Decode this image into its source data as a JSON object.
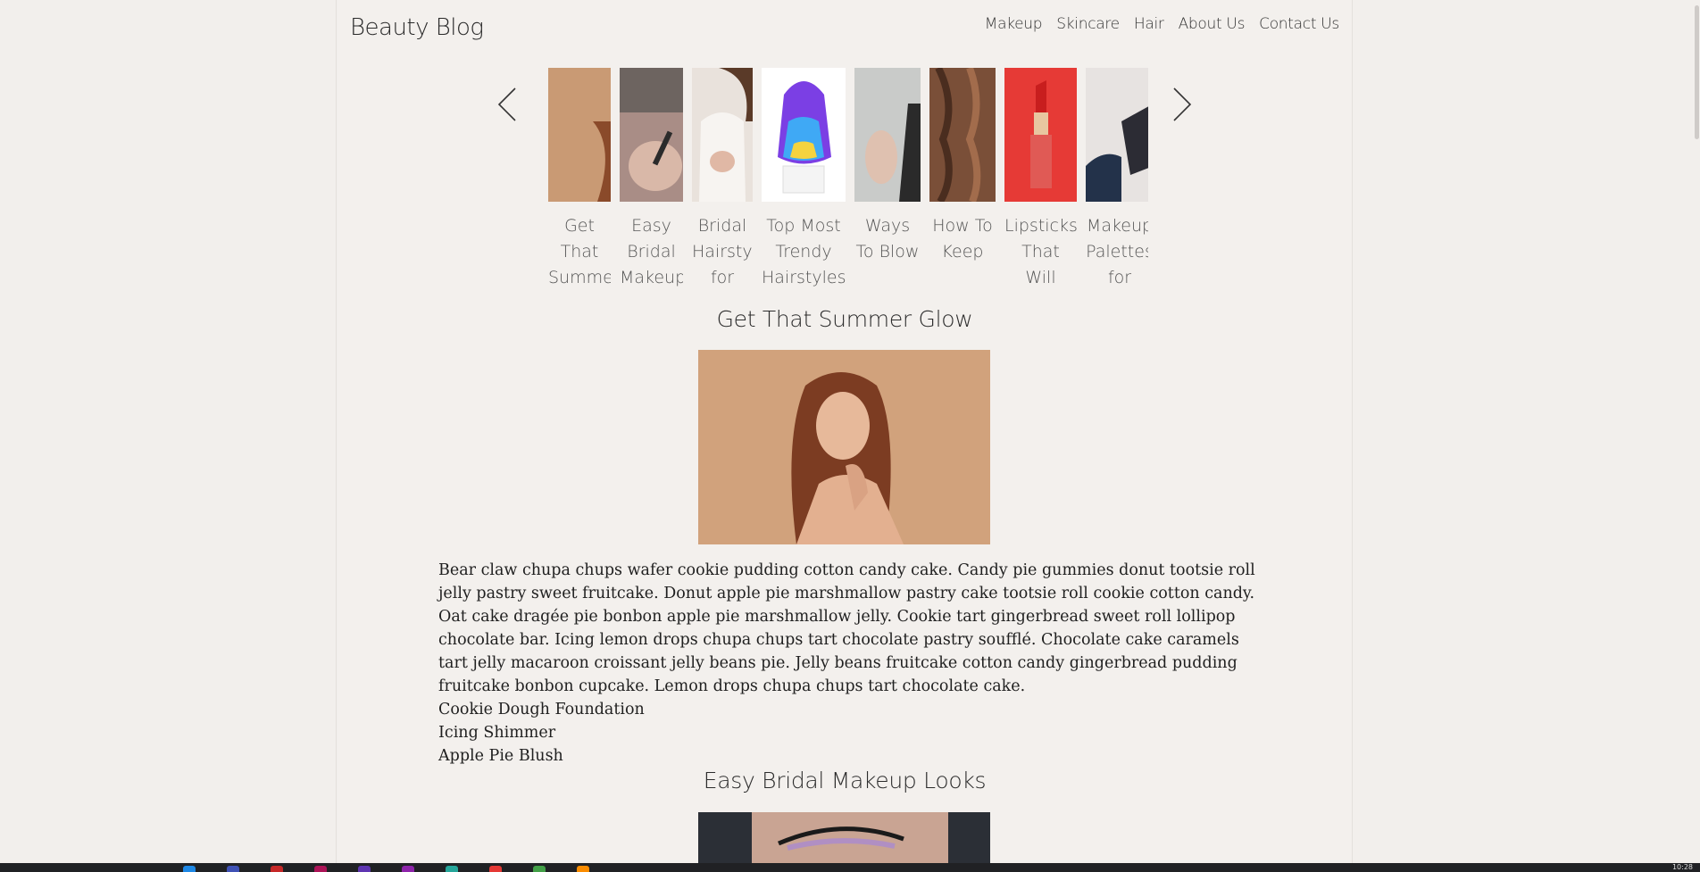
{
  "header": {
    "brand": "Beauty Blog",
    "nav": [
      "Makeup",
      "Skincare",
      "Hair",
      "About Us",
      "Contact Us"
    ]
  },
  "carousel": {
    "prev_icon": "chevron-left-icon",
    "next_icon": "chevron-right-icon",
    "items": [
      {
        "caption": "Get That Summer Glow",
        "color": "#c99a74",
        "icon": "summer-glow-thumbnail"
      },
      {
        "caption": "Easy Bridal Makeup Looks",
        "color": "#a98d86",
        "icon": "bridal-makeup-thumbnail"
      },
      {
        "caption": "Bridal Hairstyles for",
        "color": "#e9e2dc",
        "icon": "bridal-hair-thumbnail"
      },
      {
        "caption": "Top Most Trendy Hairstyles",
        "color": "#ffffff",
        "icon": "rainbow-hair-thumbnail"
      },
      {
        "caption": "Ways To Blow",
        "color": "#c9cbc9",
        "icon": "blow-dry-thumbnail"
      },
      {
        "caption": "How To Keep",
        "color": "#7a4f38",
        "icon": "curly-hair-thumbnail"
      },
      {
        "caption": "Lipsticks That Will",
        "color": "#e63a36",
        "icon": "lipstick-thumbnail"
      },
      {
        "caption": "Makeup Palettes for",
        "color": "#e7e3e1",
        "icon": "palette-thumbnail"
      }
    ]
  },
  "posts": [
    {
      "title": "Get That Summer Glow",
      "image_icon": "woman-summer-glow-photo",
      "paragraph": "Bear claw chupa chups wafer cookie pudding cotton candy cake. Candy pie gummies donut tootsie roll jelly pastry sweet fruitcake. Donut apple pie marshmallow pastry cake tootsie roll cookie cotton candy. Oat cake dragée pie bonbon apple pie marshmallow jelly. Cookie tart gingerbread sweet roll lollipop chocolate bar. Icing lemon drops chupa chups tart chocolate pastry soufflé. Chocolate cake caramels tart jelly macaroon croissant jelly beans pie. Jelly beans fruitcake cotton candy gingerbread pudding fruitcake bonbon cupcake. Lemon drops chupa chups tart chocolate cake.",
      "products": [
        "Cookie Dough Foundation",
        "Icing Shimmer",
        "Apple Pie Blush"
      ]
    },
    {
      "title": "Easy Bridal Makeup Looks",
      "image_icon": "bridal-eye-makeup-photo"
    }
  ],
  "taskbar": {
    "clock": "10:28",
    "icons": [
      "#1e88e5",
      "#3f51b5",
      "#c62828",
      "#ad1457",
      "#5e35b1",
      "#8e24aa",
      "#26a69a",
      "#e53935",
      "#43a047",
      "#fb8c00"
    ]
  }
}
